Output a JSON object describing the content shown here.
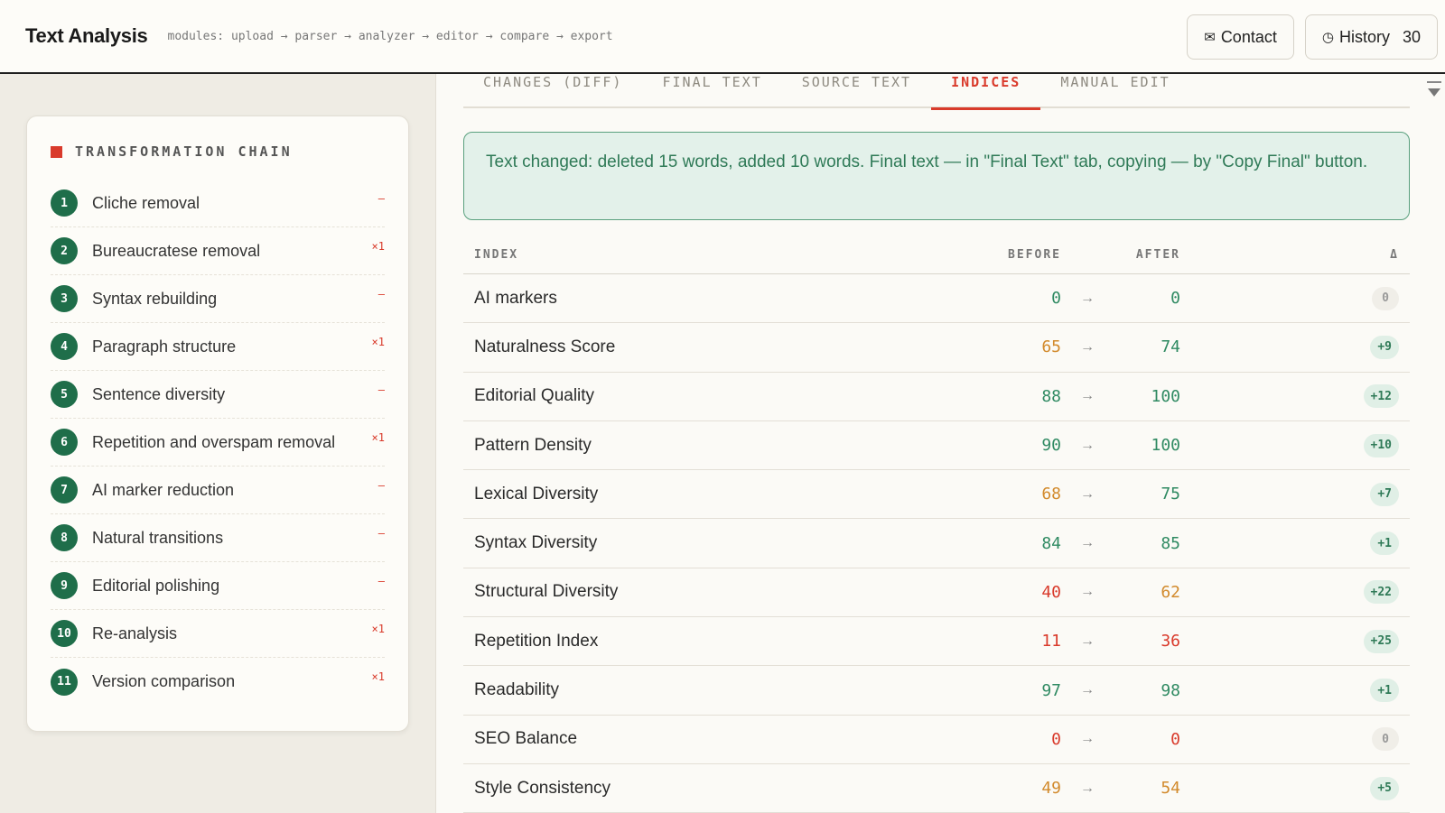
{
  "header": {
    "title": "Text Analysis",
    "breadcrumb": "modules: upload → parser → analyzer → editor → compare → export",
    "contact_label": "Contact",
    "history_label": "History",
    "history_count": "30"
  },
  "sidebar": {
    "title": "TRANSFORMATION CHAIN",
    "steps": [
      {
        "num": "1",
        "label": "Cliche removal",
        "mark": "—"
      },
      {
        "num": "2",
        "label": "Bureaucratese removal",
        "mark": "×1"
      },
      {
        "num": "3",
        "label": "Syntax rebuilding",
        "mark": "—"
      },
      {
        "num": "4",
        "label": "Paragraph structure",
        "mark": "×1"
      },
      {
        "num": "5",
        "label": "Sentence diversity",
        "mark": "—"
      },
      {
        "num": "6",
        "label": "Repetition and overspam removal",
        "mark": "×1"
      },
      {
        "num": "7",
        "label": "AI marker reduction",
        "mark": "—"
      },
      {
        "num": "8",
        "label": "Natural transitions",
        "mark": "—"
      },
      {
        "num": "9",
        "label": "Editorial polishing",
        "mark": "—"
      },
      {
        "num": "10",
        "label": "Re-analysis",
        "mark": "×1"
      },
      {
        "num": "11",
        "label": "Version comparison",
        "mark": "×1"
      }
    ]
  },
  "tabs": [
    {
      "label": "CHANGES (DIFF)",
      "active": false
    },
    {
      "label": "FINAL TEXT",
      "active": false
    },
    {
      "label": "SOURCE TEXT",
      "active": false
    },
    {
      "label": "INDICES",
      "active": true
    },
    {
      "label": "MANUAL EDIT",
      "active": false
    }
  ],
  "notice": "Text changed: deleted 15 words, added 10 words. Final text — in \"Final Text\" tab, copying — by \"Copy Final\" button.",
  "table": {
    "headers": {
      "index": "INDEX",
      "before": "BEFORE",
      "after": "AFTER",
      "delta": "Δ"
    },
    "arrow": "→",
    "rows": [
      {
        "name": "AI markers",
        "before": "0",
        "before_color": "#2f8a62",
        "after": "0",
        "after_color": "#2f8a62",
        "delta": "0",
        "delta_kind": "zero"
      },
      {
        "name": "Naturalness Score",
        "before": "65",
        "before_color": "#d28a2c",
        "after": "74",
        "after_color": "#2f8a62",
        "delta": "+9",
        "delta_kind": "pos"
      },
      {
        "name": "Editorial Quality",
        "before": "88",
        "before_color": "#2f8a62",
        "after": "100",
        "after_color": "#2f8a62",
        "delta": "+12",
        "delta_kind": "pos"
      },
      {
        "name": "Pattern Density",
        "before": "90",
        "before_color": "#2f8a62",
        "after": "100",
        "after_color": "#2f8a62",
        "delta": "+10",
        "delta_kind": "pos"
      },
      {
        "name": "Lexical Diversity",
        "before": "68",
        "before_color": "#d28a2c",
        "after": "75",
        "after_color": "#2f8a62",
        "delta": "+7",
        "delta_kind": "pos"
      },
      {
        "name": "Syntax Diversity",
        "before": "84",
        "before_color": "#2f8a62",
        "after": "85",
        "after_color": "#2f8a62",
        "delta": "+1",
        "delta_kind": "pos"
      },
      {
        "name": "Structural Diversity",
        "before": "40",
        "before_color": "#d93a2b",
        "after": "62",
        "after_color": "#d28a2c",
        "delta": "+22",
        "delta_kind": "pos"
      },
      {
        "name": "Repetition Index",
        "before": "11",
        "before_color": "#d93a2b",
        "after": "36",
        "after_color": "#d93a2b",
        "delta": "+25",
        "delta_kind": "pos"
      },
      {
        "name": "Readability",
        "before": "97",
        "before_color": "#2f8a62",
        "after": "98",
        "after_color": "#2f8a62",
        "delta": "+1",
        "delta_kind": "pos"
      },
      {
        "name": "SEO Balance",
        "before": "0",
        "before_color": "#d93a2b",
        "after": "0",
        "after_color": "#d93a2b",
        "delta": "0",
        "delta_kind": "zero"
      },
      {
        "name": "Style Consistency",
        "before": "49",
        "before_color": "#d28a2c",
        "after": "54",
        "after_color": "#d28a2c",
        "delta": "+5",
        "delta_kind": "pos"
      }
    ]
  }
}
